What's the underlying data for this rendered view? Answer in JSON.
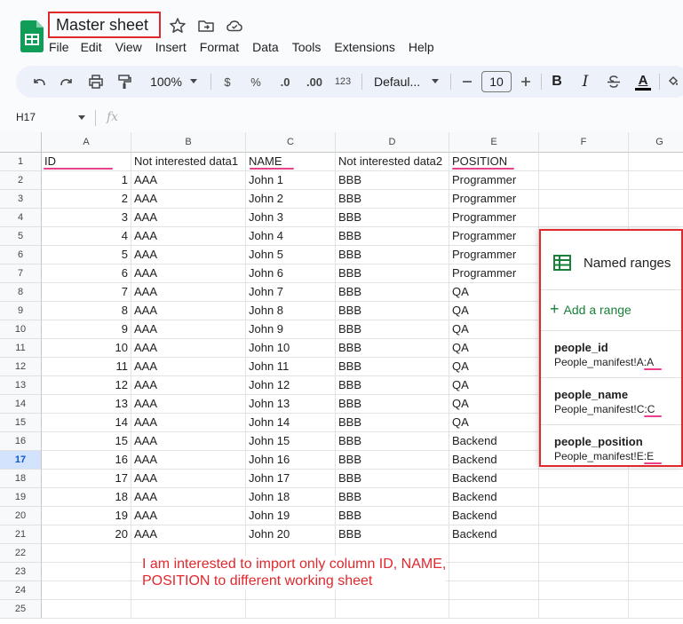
{
  "header": {
    "title": "Master sheet",
    "menu": [
      "File",
      "Edit",
      "View",
      "Insert",
      "Format",
      "Data",
      "Tools",
      "Extensions",
      "Help"
    ]
  },
  "toolbar": {
    "zoom": "100%",
    "currency": "$",
    "percent": "%",
    "decrease_decimal": ".0",
    "increase_decimal": ".00",
    "number_format": "123",
    "font": "Defaul...",
    "font_size": "10",
    "bold": "B",
    "italic": "I",
    "text_color": "A"
  },
  "formula_bar": {
    "cell_ref": "H17",
    "fx": "fx"
  },
  "columns": [
    "A",
    "B",
    "C",
    "D",
    "E",
    "F",
    "G"
  ],
  "rows": [
    "1",
    "2",
    "3",
    "4",
    "5",
    "6",
    "7",
    "8",
    "9",
    "10",
    "11",
    "12",
    "13",
    "14",
    "15",
    "16",
    "17",
    "18",
    "19",
    "20",
    "21",
    "22",
    "23",
    "24",
    "25"
  ],
  "active_row": "17",
  "table": {
    "headers": [
      "ID",
      "Not interested data1",
      "NAME",
      "Not interested data2",
      "POSITION"
    ],
    "rows": [
      [
        "1",
        "AAA",
        "John 1",
        "BBB",
        "Programmer"
      ],
      [
        "2",
        "AAA",
        "John 2",
        "BBB",
        "Programmer"
      ],
      [
        "3",
        "AAA",
        "John 3",
        "BBB",
        "Programmer"
      ],
      [
        "4",
        "AAA",
        "John 4",
        "BBB",
        "Programmer"
      ],
      [
        "5",
        "AAA",
        "John 5",
        "BBB",
        "Programmer"
      ],
      [
        "6",
        "AAA",
        "John 6",
        "BBB",
        "Programmer"
      ],
      [
        "7",
        "AAA",
        "John 7",
        "BBB",
        "QA"
      ],
      [
        "8",
        "AAA",
        "John 8",
        "BBB",
        "QA"
      ],
      [
        "9",
        "AAA",
        "John 9",
        "BBB",
        "QA"
      ],
      [
        "10",
        "AAA",
        "John 10",
        "BBB",
        "QA"
      ],
      [
        "11",
        "AAA",
        "John 11",
        "BBB",
        "QA"
      ],
      [
        "12",
        "AAA",
        "John 12",
        "BBB",
        "QA"
      ],
      [
        "13",
        "AAA",
        "John 13",
        "BBB",
        "QA"
      ],
      [
        "14",
        "AAA",
        "John 14",
        "BBB",
        "QA"
      ],
      [
        "15",
        "AAA",
        "John 15",
        "BBB",
        "Backend"
      ],
      [
        "16",
        "AAA",
        "John 16",
        "BBB",
        "Backend"
      ],
      [
        "17",
        "AAA",
        "John 17",
        "BBB",
        "Backend"
      ],
      [
        "18",
        "AAA",
        "John 18",
        "BBB",
        "Backend"
      ],
      [
        "19",
        "AAA",
        "John 19",
        "BBB",
        "Backend"
      ],
      [
        "20",
        "AAA",
        "John 20",
        "BBB",
        "Backend"
      ]
    ]
  },
  "annotation": {
    "line1": "I am interested to import only column ID, NAME,",
    "line2": "POSITION to different working sheet"
  },
  "named_ranges": {
    "title": "Named ranges",
    "add_label": "Add a range",
    "items": [
      {
        "name": "people_id",
        "range": "People_manifest!A:A"
      },
      {
        "name": "people_name",
        "range": "People_manifest!C:C"
      },
      {
        "name": "people_position",
        "range": "People_manifest!E:E"
      }
    ]
  },
  "colors": {
    "highlight_box": "#e0282d",
    "underline": "#e8408c",
    "sheets_green": "#188038"
  }
}
